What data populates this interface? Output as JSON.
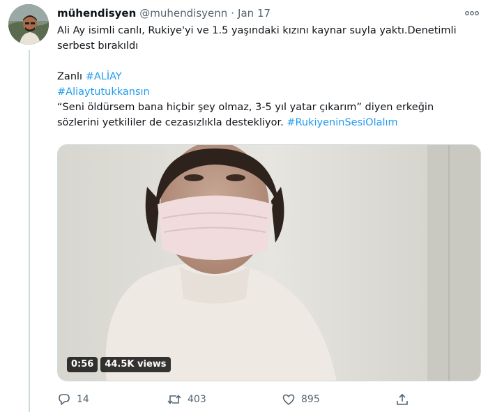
{
  "tweet": {
    "display_name": "mühendisyen",
    "handle": "@muhendisyenn",
    "separator": "·",
    "date": "Jan 17",
    "text_line1": "Ali Ay isimli canlı, Rukiye'yi ve 1.5 yaşındaki kızını kaynar suyla yaktı.Denetimli",
    "text_line2": "serbest bırakıldı",
    "text_zanli": "Zanlı",
    "hashtag_aliay": "#ALİAY",
    "hashtag_tutukkansin": "#Aliaytutukkansın",
    "quote_line1": "“Seni öldürsem bana hiçbir şey olmaz, 3-5 yıl yatar çıkarım” diyen erkeğin",
    "quote_line2": "sözlerini yetkililer de cezasızlıkla destekliyor.",
    "hashtag_rukiye": "#RukiyeninSesiOlalım"
  },
  "video": {
    "duration": "0:56",
    "views": "44.5K views"
  },
  "actions": {
    "reply_count": "14",
    "retweet_count": "403",
    "like_count": "895"
  },
  "icons": {
    "more": "more-horizontal-icon",
    "reply": "reply-icon",
    "retweet": "retweet-icon",
    "like": "heart-icon",
    "share": "share-icon"
  },
  "colors": {
    "link": "#1d9bf0",
    "secondary_text": "#536471",
    "primary_text": "#0f1419"
  }
}
